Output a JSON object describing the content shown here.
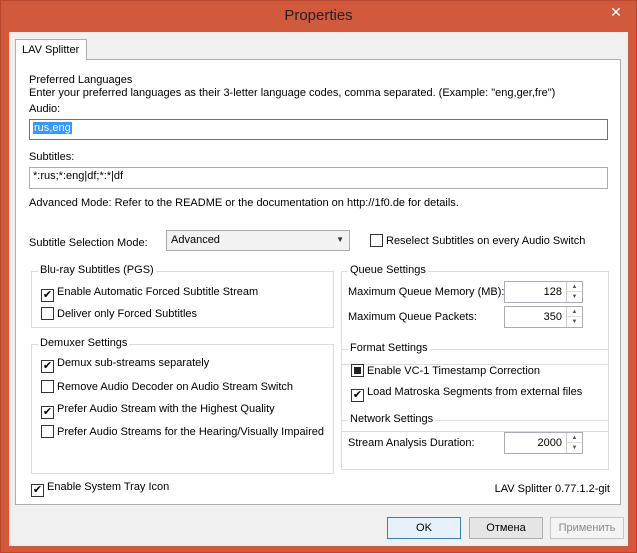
{
  "window": {
    "title": "Properties",
    "close_glyph": "✕"
  },
  "tab": {
    "label": "LAV Splitter"
  },
  "preferred": {
    "heading": "Preferred Languages",
    "description": "Enter your preferred languages as their 3-letter language codes, comma separated. (Example: \"eng,ger,fre\")",
    "audio_label": "Audio:",
    "audio_value": "rus,eng",
    "subtitles_label": "Subtitles:",
    "subtitles_value": "*:rus;*:eng|df;*:*|df",
    "advanced_note": "Advanced Mode: Refer to the README or the documentation on http://1f0.de for details."
  },
  "subtitle_mode": {
    "label": "Subtitle Selection Mode:",
    "value": "Advanced",
    "reselect_label": "Reselect Subtitles on every Audio Switch",
    "reselect_checked": false
  },
  "bluray": {
    "title": "Blu-ray Subtitles (PGS)",
    "items": [
      {
        "label": "Enable Automatic Forced Subtitle Stream",
        "checked": true
      },
      {
        "label": "Deliver only Forced Subtitles",
        "checked": false
      }
    ]
  },
  "queue": {
    "title": "Queue Settings",
    "memory_label": "Maximum Queue Memory (MB):",
    "memory_value": "128",
    "packets_label": "Maximum Queue Packets:",
    "packets_value": "350"
  },
  "demuxer": {
    "title": "Demuxer Settings",
    "items": [
      {
        "label": "Demux sub-streams separately",
        "checked": true
      },
      {
        "label": "Remove Audio Decoder on Audio Stream Switch",
        "checked": false
      },
      {
        "label": "Prefer Audio Stream with the Highest Quality",
        "checked": true
      },
      {
        "label": "Prefer Audio Streams for the Hearing/Visually Impaired",
        "checked": false
      }
    ]
  },
  "format": {
    "title": "Format Settings",
    "vc1_label": "Enable VC-1 Timestamp Correction",
    "vc1_state": "indeterminate",
    "matroska_label": "Load Matroska Segments from external files",
    "matroska_checked": true
  },
  "network": {
    "title": "Network Settings",
    "duration_label": "Stream Analysis Duration:",
    "duration_value": "2000"
  },
  "tray": {
    "label": "Enable System Tray Icon",
    "checked": true
  },
  "version": "LAV Splitter 0.77.1.2-git",
  "buttons": {
    "ok": "OK",
    "cancel": "Отмена",
    "apply": "Применить"
  },
  "glyphs": {
    "check": "✔",
    "combo_arrow": "▼",
    "spin_up": "▲",
    "spin_down": "▼"
  },
  "colors": {
    "titlebar": "#d25a3c",
    "selection": "#3399ff"
  }
}
